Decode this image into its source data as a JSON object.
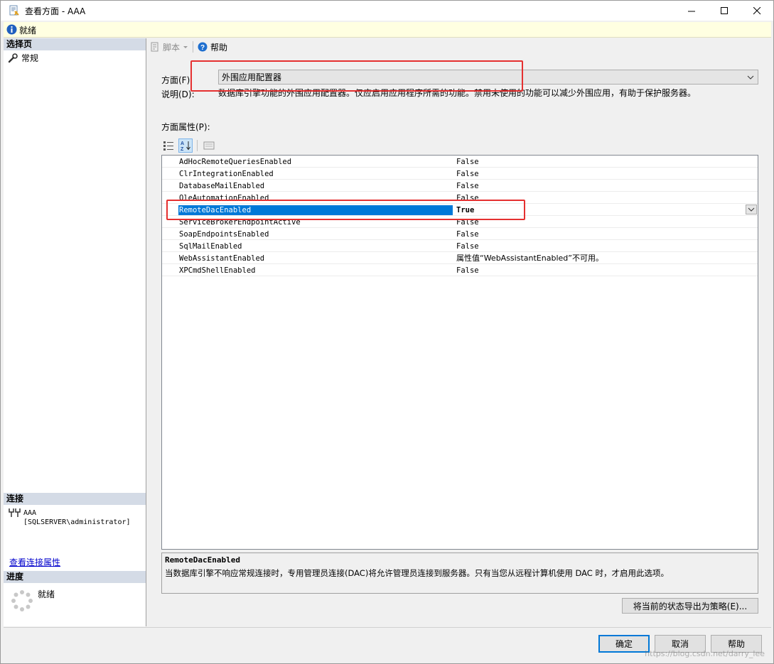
{
  "window": {
    "title": "查看方面 - AAA",
    "status": "就绪"
  },
  "left": {
    "select_page_header": "选择页",
    "pages": [
      {
        "label": "常规",
        "icon": "wrench-icon"
      }
    ],
    "connection_header": "连接",
    "connection_name": "AAA",
    "connection_user": "[SQLSERVER\\administrator]",
    "view_connection_link": "查看连接属性",
    "progress_header": "进度",
    "progress_status": "就绪"
  },
  "toolbar": {
    "script_label": "脚本",
    "help_label": "帮助"
  },
  "facet": {
    "facet_label": "方面(F):",
    "facet_value": "外围应用配置器",
    "desc_label": "说明(D):",
    "desc_text": "数据库引擎功能的外围应用配置器。仅应启用应用程序所需的功能。禁用未使用的功能可以减少外围应用，有助于保护服务器。",
    "props_label": "方面属性(P):"
  },
  "properties": [
    {
      "name": "AdHocRemoteQueriesEnabled",
      "value": "False"
    },
    {
      "name": "ClrIntegrationEnabled",
      "value": "False"
    },
    {
      "name": "DatabaseMailEnabled",
      "value": "False"
    },
    {
      "name": "OleAutomationEnabled",
      "value": "False"
    },
    {
      "name": "RemoteDacEnabled",
      "value": "True",
      "selected": true
    },
    {
      "name": "ServiceBrokerEndpointActive",
      "value": "False"
    },
    {
      "name": "SoapEndpointsEnabled",
      "value": "False"
    },
    {
      "name": "SqlMailEnabled",
      "value": "False"
    },
    {
      "name": "WebAssistantEnabled",
      "value": "属性值“WebAssistantEnabled”不可用。"
    },
    {
      "name": "XPCmdShellEnabled",
      "value": "False"
    }
  ],
  "description_panel": {
    "title": "RemoteDacEnabled",
    "text": "当数据库引擎不响应常规连接时，专用管理员连接(DAC)将允许管理员连接到服务器。只有当您从远程计算机使用 DAC 时，才启用此选项。"
  },
  "buttons": {
    "export_policy": "将当前的状态导出为策略(E)...",
    "ok": "确定",
    "cancel": "取消",
    "help": "帮助"
  },
  "watermark": "https://blog.csdn.net/darry_lee",
  "colors": {
    "selection": "#0078d7",
    "highlight_box": "#e53030",
    "status_bg": "#ffffe1"
  }
}
